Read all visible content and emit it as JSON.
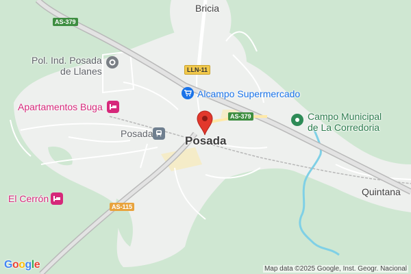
{
  "places": {
    "bricia": "Bricia",
    "posada": "Posada",
    "quintana": "Quintana",
    "pol_ind_line1": "Pol. Ind. Posada",
    "pol_ind_line2": "de Llanes",
    "apartamentos": "Apartamentos Buga",
    "el_cerron": "El Cerrón",
    "alcampo": "Alcampo Supermercado",
    "posada_station": "Posada",
    "campo_line1": "Campo Municipal",
    "campo_line2": "de La Corredoria"
  },
  "roads": {
    "as379_top": "AS-379",
    "lln11": "LLN-11",
    "as379_mid": "AS-379",
    "as115": "AS-115"
  },
  "attribution": "Map data ©2025 Google, Inst. Geogr. Nacional",
  "logo": "Google",
  "colors": {
    "forest": "#cfe7d2",
    "urban": "#eef0ee",
    "road": "#ffffff",
    "river": "#7fd0e6",
    "pin": "#e2382c",
    "poi_pink": "#d6287a",
    "poi_blue": "#1a73e8",
    "poi_green": "#2e7d4f"
  },
  "icons": {
    "pol_ind": "industrial-icon",
    "apartamentos": "hotel-icon",
    "el_cerron": "hotel-icon",
    "alcampo": "shopping-cart-icon",
    "posada_station": "train-icon",
    "campo": "stadium-icon",
    "pin": "map-pin-icon"
  }
}
